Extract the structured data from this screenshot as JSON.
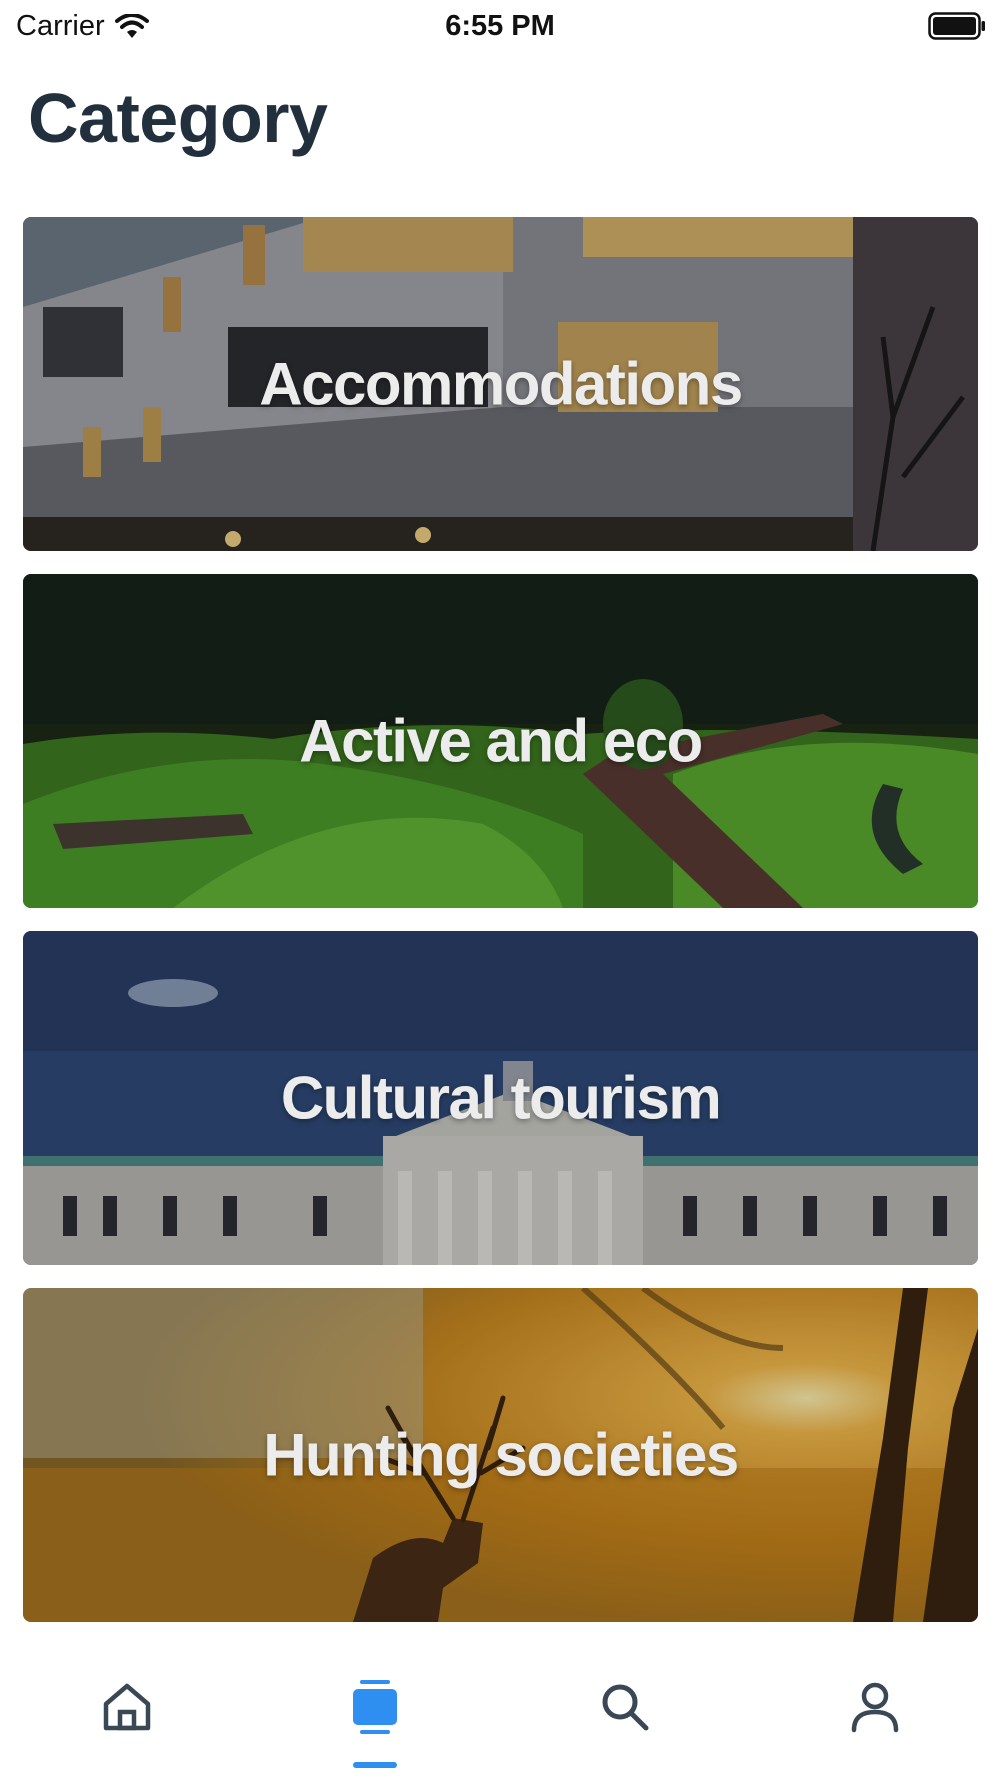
{
  "status_bar": {
    "carrier": "Carrier",
    "time": "6:55 PM"
  },
  "page": {
    "title": "Category"
  },
  "categories": [
    {
      "label": "Accommodations"
    },
    {
      "label": "Active and eco"
    },
    {
      "label": "Cultural tourism"
    },
    {
      "label": "Hunting societies"
    }
  ],
  "tab_bar": {
    "tabs": [
      {
        "icon": "home-icon",
        "active": false
      },
      {
        "icon": "category-icon",
        "active": true
      },
      {
        "icon": "search-icon",
        "active": false
      },
      {
        "icon": "profile-icon",
        "active": false
      }
    ],
    "active_color": "#2f8ff0",
    "inactive_color": "#3a4856"
  }
}
